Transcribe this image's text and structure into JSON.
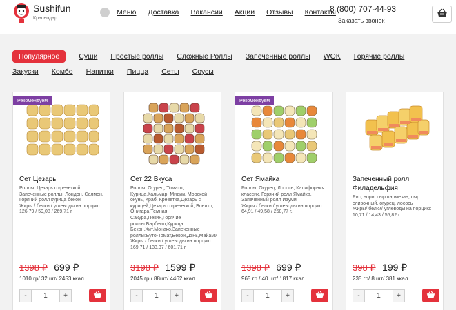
{
  "header": {
    "brand": "Sushifun",
    "city": "Краснодар",
    "nav": [
      "Меню",
      "Доставка",
      "Вакансии",
      "Акции",
      "Отзывы",
      "Контакты"
    ],
    "phone": "8 (800) 707-44-93",
    "callback": "Заказать звонок",
    "cart_icon": "basket-icon",
    "accent_color": "#e4323c"
  },
  "categories": [
    "Популярное",
    "Суши",
    "Простые роллы",
    "Сложные Роллы",
    "Запеченные роллы",
    "WOK",
    "Горячие роллы",
    "Закуски",
    "Комбо",
    "Напитки",
    "Пицца",
    "Сеты",
    "Соусы"
  ],
  "active_category": "Популярное",
  "products": [
    {
      "badge": "Рекомендуем",
      "title": "Сет Цезарь",
      "description": "Роллы: Цезарь с креветкой, Запеченные роллы: Лондон, Селмон, Горячий ролл курица бекон\nЖиры / белки / углеводы на порцию:\n126,79 / 59,08 / 269,71 г.",
      "old_price": "1398 ₽",
      "price": "699 ₽",
      "info": "1010 гр/ 32 шт/ 2453 ккал.",
      "quantity": "1"
    },
    {
      "badge": "",
      "title": "Сет 22 Вкуса",
      "description": "Роллы: Огурец, Томато, Курица,Кальмар, Мидии, Морской окунь, Краб, Креветка,Цезарь с курицей,Цезарь с креветкой, Бонито, Онигара,Темная Сакура,Пекин,Горячие роллы:Барбекю,Курица Бекон,Хит,Монако,Запеченные роллы:Буто-Томат,Бекон,Дэнь,Майами\nЖиры / белки / углеводы на порцию:\n169,71 / 133,37 / 601,71 г.",
      "old_price": "3198 ₽",
      "price": "1599 ₽",
      "info": "2045 гр / 88шт/ 4462 ккал.",
      "quantity": "1"
    },
    {
      "badge": "Рекомендуем",
      "title": "Сет Ямайка",
      "description": "Роллы: Огурец, Лосось, Калифорния классик, Горячий ролл Ямайка, Запеченный ролл Изуми\nЖиры / белки / углеводы на порцию:\n64,91 / 49,58 / 258,77 г.",
      "old_price": "1398 ₽",
      "price": "699 ₽",
      "info": "965 гр / 40 шт/ 1817 ккал.",
      "quantity": "1"
    },
    {
      "badge": "",
      "title": "Запеченный ролл Филадельфия",
      "description": "Рис, нори, сыр пармезан, сыр сливочный, огурец, лосось\nЖиры/ белки/ углеводы на порцию:\n10,71 / 14,43 / 55,82 г.",
      "old_price": "398 ₽",
      "price": "199 ₽",
      "info": "235 гр/ 8 шт/ 381 ккал.",
      "quantity": "1"
    }
  ]
}
